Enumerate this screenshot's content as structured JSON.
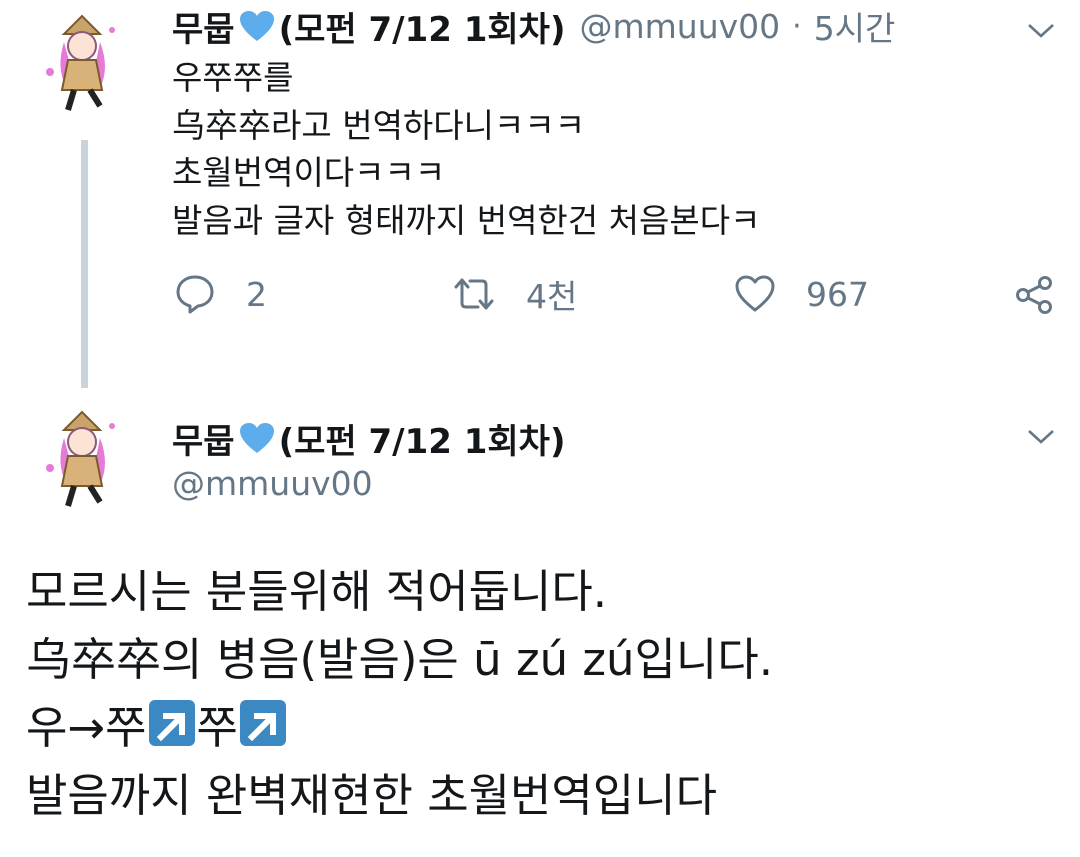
{
  "tweet1": {
    "display_name": "무뭅",
    "name_suffix": "(모펀 7/12 1회차)",
    "handle": "@mmuuv00",
    "separator": "·",
    "time": "5시간",
    "lines": [
      "우쭈쭈를",
      "乌卒卒라고 번역하다니ㅋㅋㅋ",
      "초월번역이다ㅋㅋㅋ",
      "발음과 글자 형태까지 번역한건 처음본다ㅋ"
    ],
    "reply_count": "2",
    "retweet_count": "4천",
    "like_count": "967"
  },
  "tweet2": {
    "display_name": "무뭅",
    "name_suffix": "(모펀 7/12 1회차)",
    "handle": "@mmuuv00",
    "body": {
      "line1": "모르시는 분들위해 적어둡니다.",
      "line2": "乌卒卒의 병음(발음)은 ū zú zú입니다.",
      "line3_part1": "우→쭈",
      "line3_part2": "쭈",
      "line4": "발음까지 완벽재현한 초월번역입니다"
    }
  },
  "colors": {
    "text": "#14171a",
    "secondary": "#657786",
    "heart_emoji": "#5dadec",
    "thread_line": "#c8d3dc",
    "arrow_emoji": "#3b88c3"
  }
}
